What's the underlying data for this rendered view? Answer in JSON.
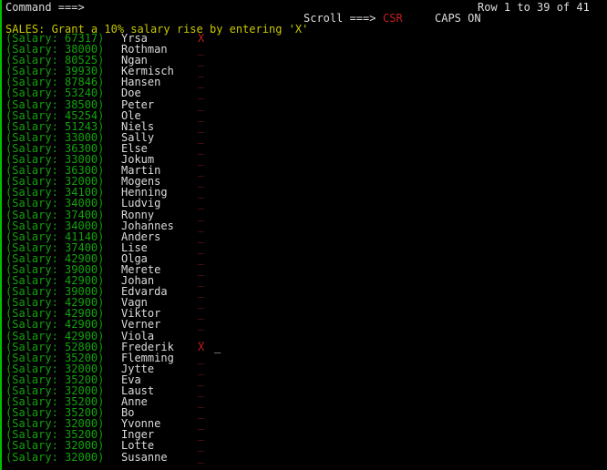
{
  "terminal": {
    "colors": {
      "background": "#000000",
      "white": "#dcdcdc",
      "green": "#13a10e",
      "yellow": "#c8c800",
      "red": "#c02020",
      "dark_red": "#8b1a1a",
      "border_green": "#00c000",
      "cursor": "#e8e8e8"
    }
  },
  "header": {
    "command_prompt": "Command ===>",
    "command_value": "",
    "row_indicator": "Row 1 to 39 of 41",
    "scroll_prompt": "Scroll ===>",
    "scroll_value": "CSR",
    "caps_indicator": "CAPS ON",
    "title": "SALES: Grant a 10% salary rise by entering 'X'"
  },
  "grid": {
    "salary_prefix": "(Salary:",
    "salary_suffix": ")",
    "blank_marker": "_",
    "flag_marker": "X",
    "cursor_glyph": "_",
    "rows": [
      {
        "salary": "67317",
        "name": "Yrsa",
        "marker": "X",
        "flagged": true,
        "cursor": false
      },
      {
        "salary": "38000",
        "name": "Rothman",
        "marker": "_",
        "flagged": false,
        "cursor": false
      },
      {
        "salary": "80525",
        "name": "Ngan",
        "marker": "_",
        "flagged": false,
        "cursor": false
      },
      {
        "salary": "39930",
        "name": "Kermisch",
        "marker": "_",
        "flagged": false,
        "cursor": false
      },
      {
        "salary": "87846",
        "name": "Hansen",
        "marker": "_",
        "flagged": false,
        "cursor": false
      },
      {
        "salary": "53240",
        "name": "Doe",
        "marker": "_",
        "flagged": false,
        "cursor": false
      },
      {
        "salary": "38500",
        "name": "Peter",
        "marker": "_",
        "flagged": false,
        "cursor": false
      },
      {
        "salary": "45254",
        "name": "Ole",
        "marker": "_",
        "flagged": false,
        "cursor": false
      },
      {
        "salary": "51243",
        "name": "Niels",
        "marker": "_",
        "flagged": false,
        "cursor": false
      },
      {
        "salary": "33000",
        "name": "Sally",
        "marker": "_",
        "flagged": false,
        "cursor": false
      },
      {
        "salary": "36300",
        "name": "Else",
        "marker": "_",
        "flagged": false,
        "cursor": false
      },
      {
        "salary": "33000",
        "name": "Jokum",
        "marker": "_",
        "flagged": false,
        "cursor": false
      },
      {
        "salary": "36300",
        "name": "Martin",
        "marker": "_",
        "flagged": false,
        "cursor": false
      },
      {
        "salary": "32000",
        "name": "Mogens",
        "marker": "_",
        "flagged": false,
        "cursor": false
      },
      {
        "salary": "34100",
        "name": "Henning",
        "marker": "_",
        "flagged": false,
        "cursor": false
      },
      {
        "salary": "34000",
        "name": "Ludvig",
        "marker": "_",
        "flagged": false,
        "cursor": false
      },
      {
        "salary": "37400",
        "name": "Ronny",
        "marker": "_",
        "flagged": false,
        "cursor": false
      },
      {
        "salary": "34000",
        "name": "Johannes",
        "marker": "_",
        "flagged": false,
        "cursor": false
      },
      {
        "salary": "41140",
        "name": "Anders",
        "marker": "_",
        "flagged": false,
        "cursor": false
      },
      {
        "salary": "37400",
        "name": "Lise",
        "marker": "_",
        "flagged": false,
        "cursor": false
      },
      {
        "salary": "42900",
        "name": "Olga",
        "marker": "_",
        "flagged": false,
        "cursor": false
      },
      {
        "salary": "39000",
        "name": "Merete",
        "marker": "_",
        "flagged": false,
        "cursor": false
      },
      {
        "salary": "42900",
        "name": "Johan",
        "marker": "_",
        "flagged": false,
        "cursor": false
      },
      {
        "salary": "39000",
        "name": "Edvarda",
        "marker": "_",
        "flagged": false,
        "cursor": false
      },
      {
        "salary": "42900",
        "name": "Vagn",
        "marker": "_",
        "flagged": false,
        "cursor": false
      },
      {
        "salary": "42900",
        "name": "Viktor",
        "marker": "_",
        "flagged": false,
        "cursor": false
      },
      {
        "salary": "42900",
        "name": "Verner",
        "marker": "_",
        "flagged": false,
        "cursor": false
      },
      {
        "salary": "42900",
        "name": "Viola",
        "marker": "_",
        "flagged": false,
        "cursor": false
      },
      {
        "salary": "52800",
        "name": "Frederik",
        "marker": "X",
        "flagged": true,
        "cursor": true
      },
      {
        "salary": "35200",
        "name": "Flemming",
        "marker": "_",
        "flagged": false,
        "cursor": false
      },
      {
        "salary": "32000",
        "name": "Jytte",
        "marker": "_",
        "flagged": false,
        "cursor": false
      },
      {
        "salary": "35200",
        "name": "Eva",
        "marker": "_",
        "flagged": false,
        "cursor": false
      },
      {
        "salary": "32000",
        "name": "Laust",
        "marker": "_",
        "flagged": false,
        "cursor": false
      },
      {
        "salary": "35200",
        "name": "Anne",
        "marker": "_",
        "flagged": false,
        "cursor": false
      },
      {
        "salary": "35200",
        "name": "Bo",
        "marker": "_",
        "flagged": false,
        "cursor": false
      },
      {
        "salary": "32000",
        "name": "Yvonne",
        "marker": "_",
        "flagged": false,
        "cursor": false
      },
      {
        "salary": "35200",
        "name": "Inger",
        "marker": "_",
        "flagged": false,
        "cursor": false
      },
      {
        "salary": "32000",
        "name": "Lotte",
        "marker": "_",
        "flagged": false,
        "cursor": false
      },
      {
        "salary": "32000",
        "name": "Susanne",
        "marker": "_",
        "flagged": false,
        "cursor": false
      }
    ]
  }
}
